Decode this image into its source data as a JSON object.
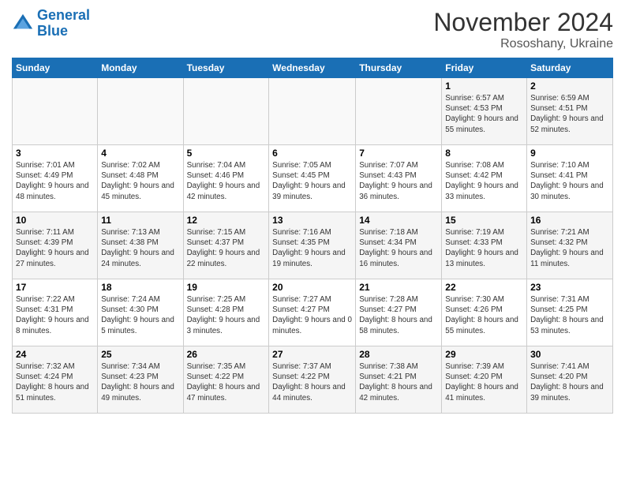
{
  "logo": {
    "line1": "General",
    "line2": "Blue"
  },
  "title": "November 2024",
  "subtitle": "Rososhany, Ukraine",
  "days_of_week": [
    "Sunday",
    "Monday",
    "Tuesday",
    "Wednesday",
    "Thursday",
    "Friday",
    "Saturday"
  ],
  "weeks": [
    [
      {
        "day": "",
        "info": ""
      },
      {
        "day": "",
        "info": ""
      },
      {
        "day": "",
        "info": ""
      },
      {
        "day": "",
        "info": ""
      },
      {
        "day": "",
        "info": ""
      },
      {
        "day": "1",
        "info": "Sunrise: 6:57 AM\nSunset: 4:53 PM\nDaylight: 9 hours and 55 minutes."
      },
      {
        "day": "2",
        "info": "Sunrise: 6:59 AM\nSunset: 4:51 PM\nDaylight: 9 hours and 52 minutes."
      }
    ],
    [
      {
        "day": "3",
        "info": "Sunrise: 7:01 AM\nSunset: 4:49 PM\nDaylight: 9 hours and 48 minutes."
      },
      {
        "day": "4",
        "info": "Sunrise: 7:02 AM\nSunset: 4:48 PM\nDaylight: 9 hours and 45 minutes."
      },
      {
        "day": "5",
        "info": "Sunrise: 7:04 AM\nSunset: 4:46 PM\nDaylight: 9 hours and 42 minutes."
      },
      {
        "day": "6",
        "info": "Sunrise: 7:05 AM\nSunset: 4:45 PM\nDaylight: 9 hours and 39 minutes."
      },
      {
        "day": "7",
        "info": "Sunrise: 7:07 AM\nSunset: 4:43 PM\nDaylight: 9 hours and 36 minutes."
      },
      {
        "day": "8",
        "info": "Sunrise: 7:08 AM\nSunset: 4:42 PM\nDaylight: 9 hours and 33 minutes."
      },
      {
        "day": "9",
        "info": "Sunrise: 7:10 AM\nSunset: 4:41 PM\nDaylight: 9 hours and 30 minutes."
      }
    ],
    [
      {
        "day": "10",
        "info": "Sunrise: 7:11 AM\nSunset: 4:39 PM\nDaylight: 9 hours and 27 minutes."
      },
      {
        "day": "11",
        "info": "Sunrise: 7:13 AM\nSunset: 4:38 PM\nDaylight: 9 hours and 24 minutes."
      },
      {
        "day": "12",
        "info": "Sunrise: 7:15 AM\nSunset: 4:37 PM\nDaylight: 9 hours and 22 minutes."
      },
      {
        "day": "13",
        "info": "Sunrise: 7:16 AM\nSunset: 4:35 PM\nDaylight: 9 hours and 19 minutes."
      },
      {
        "day": "14",
        "info": "Sunrise: 7:18 AM\nSunset: 4:34 PM\nDaylight: 9 hours and 16 minutes."
      },
      {
        "day": "15",
        "info": "Sunrise: 7:19 AM\nSunset: 4:33 PM\nDaylight: 9 hours and 13 minutes."
      },
      {
        "day": "16",
        "info": "Sunrise: 7:21 AM\nSunset: 4:32 PM\nDaylight: 9 hours and 11 minutes."
      }
    ],
    [
      {
        "day": "17",
        "info": "Sunrise: 7:22 AM\nSunset: 4:31 PM\nDaylight: 9 hours and 8 minutes."
      },
      {
        "day": "18",
        "info": "Sunrise: 7:24 AM\nSunset: 4:30 PM\nDaylight: 9 hours and 5 minutes."
      },
      {
        "day": "19",
        "info": "Sunrise: 7:25 AM\nSunset: 4:28 PM\nDaylight: 9 hours and 3 minutes."
      },
      {
        "day": "20",
        "info": "Sunrise: 7:27 AM\nSunset: 4:27 PM\nDaylight: 9 hours and 0 minutes."
      },
      {
        "day": "21",
        "info": "Sunrise: 7:28 AM\nSunset: 4:27 PM\nDaylight: 8 hours and 58 minutes."
      },
      {
        "day": "22",
        "info": "Sunrise: 7:30 AM\nSunset: 4:26 PM\nDaylight: 8 hours and 55 minutes."
      },
      {
        "day": "23",
        "info": "Sunrise: 7:31 AM\nSunset: 4:25 PM\nDaylight: 8 hours and 53 minutes."
      }
    ],
    [
      {
        "day": "24",
        "info": "Sunrise: 7:32 AM\nSunset: 4:24 PM\nDaylight: 8 hours and 51 minutes."
      },
      {
        "day": "25",
        "info": "Sunrise: 7:34 AM\nSunset: 4:23 PM\nDaylight: 8 hours and 49 minutes."
      },
      {
        "day": "26",
        "info": "Sunrise: 7:35 AM\nSunset: 4:22 PM\nDaylight: 8 hours and 47 minutes."
      },
      {
        "day": "27",
        "info": "Sunrise: 7:37 AM\nSunset: 4:22 PM\nDaylight: 8 hours and 44 minutes."
      },
      {
        "day": "28",
        "info": "Sunrise: 7:38 AM\nSunset: 4:21 PM\nDaylight: 8 hours and 42 minutes."
      },
      {
        "day": "29",
        "info": "Sunrise: 7:39 AM\nSunset: 4:20 PM\nDaylight: 8 hours and 41 minutes."
      },
      {
        "day": "30",
        "info": "Sunrise: 7:41 AM\nSunset: 4:20 PM\nDaylight: 8 hours and 39 minutes."
      }
    ]
  ]
}
